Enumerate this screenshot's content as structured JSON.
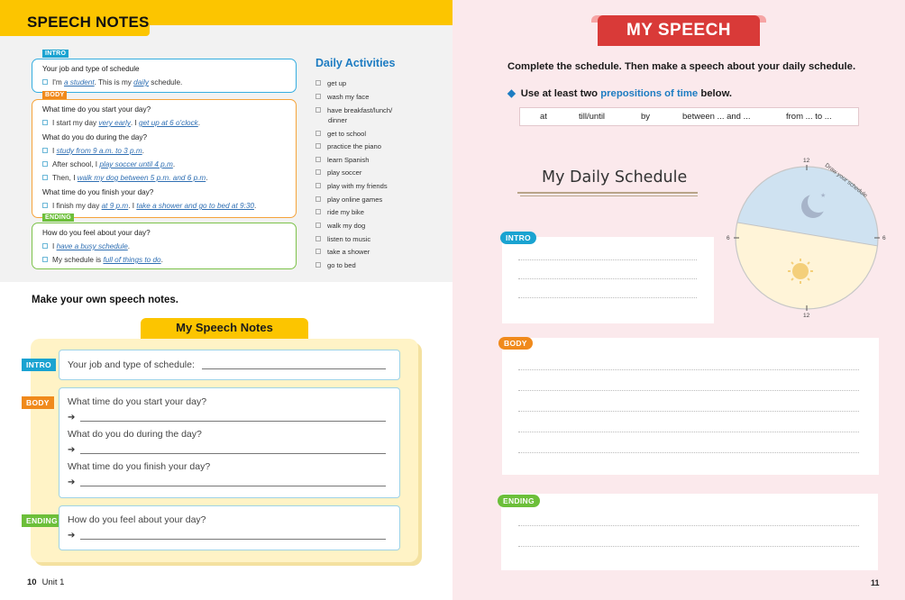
{
  "left": {
    "header_title": "SPEECH NOTES",
    "tags": {
      "intro": "INTRO",
      "body": "BODY",
      "ending": "ENDING"
    },
    "example": {
      "intro_q": "Your job and type of schedule",
      "intro_a_pre": "I'm ",
      "intro_a_it1": "a student",
      "intro_a_mid": ". This is my ",
      "intro_a_it2": "daily",
      "intro_a_post": " schedule.",
      "body_q1": "What time do you start your day?",
      "body_a1_pre": "I start my day ",
      "body_a1_it1": "very early",
      "body_a1_mid": ". I ",
      "body_a1_it2": "get up at 6 o'clock",
      "body_a1_post": ".",
      "body_q2": "What do you do during the day?",
      "body_a2_pre": "I ",
      "body_a2_it": "study from 9 a.m. to 3 p.m",
      "body_a2_post": ".",
      "body_a3_pre": "After school, I ",
      "body_a3_it": "play soccer until 4 p.m",
      "body_a3_post": ".",
      "body_a4_pre": "Then, I ",
      "body_a4_it": "walk my dog between 5 p.m. and 6 p.m",
      "body_a4_post": ".",
      "body_q3": "What time do you finish your day?",
      "body_a5_pre": "I finish my day ",
      "body_a5_it1": "at 9 p.m",
      "body_a5_mid": ". I ",
      "body_a5_it2": "take a shower and go to bed at 9:30",
      "body_a5_post": ".",
      "ending_q": "How do you feel about your day?",
      "ending_a1_pre": "I ",
      "ending_a1_it": "have a busy schedule",
      "ending_a1_post": ".",
      "ending_a2_pre": "My schedule is ",
      "ending_a2_it": "full of things to do",
      "ending_a2_post": "."
    },
    "daily_title": "Daily Activities",
    "daily_items": [
      "get up",
      "wash my face",
      "have breakfast/lunch/",
      "dinner",
      "get to school",
      "practice the piano",
      "learn Spanish",
      "play soccer",
      "play with my friends",
      "play online games",
      "ride my bike",
      "walk my dog",
      "listen to music",
      "take a shower",
      "go to bed"
    ],
    "instruction": "Make your own speech notes.",
    "notes_title": "My Speech Notes",
    "notes": {
      "intro_q": "Your job and type of schedule:",
      "body_q1": "What time do you start your day?",
      "body_q2": "What do you do during the day?",
      "body_q3": "What time do you finish your day?",
      "ending_q": "How do you feel about your day?",
      "arrow": "➔"
    },
    "page_number": "10",
    "unit_label": "Unit 1"
  },
  "right": {
    "title": "MY SPEECH",
    "instruction": "Complete the schedule. Then make a speech about your daily schedule.",
    "bullet_pre": "Use at least two ",
    "bullet_hl": "prepositions of time",
    "bullet_post": " below.",
    "prepositions": [
      "at",
      "till/until",
      "by",
      "between ... and ...",
      "from ... to ..."
    ],
    "schedule_title": "My Daily Schedule",
    "circle_text": "Draw your schedule",
    "clock": {
      "top": "12",
      "bottom": "12",
      "left": "6",
      "right": "6"
    },
    "tags": {
      "intro": "INTRO",
      "body": "BODY",
      "ending": "ENDING"
    },
    "page_number": "11"
  },
  "colors": {
    "header_yellow": "#fcc500",
    "intro_blue": "#1aa3d1",
    "body_orange": "#f08a1c",
    "ending_green": "#6cbf3a",
    "speech_red": "#d93a38",
    "right_bg": "#fbe9ec",
    "highlight_blue": "#1d7cc2"
  }
}
